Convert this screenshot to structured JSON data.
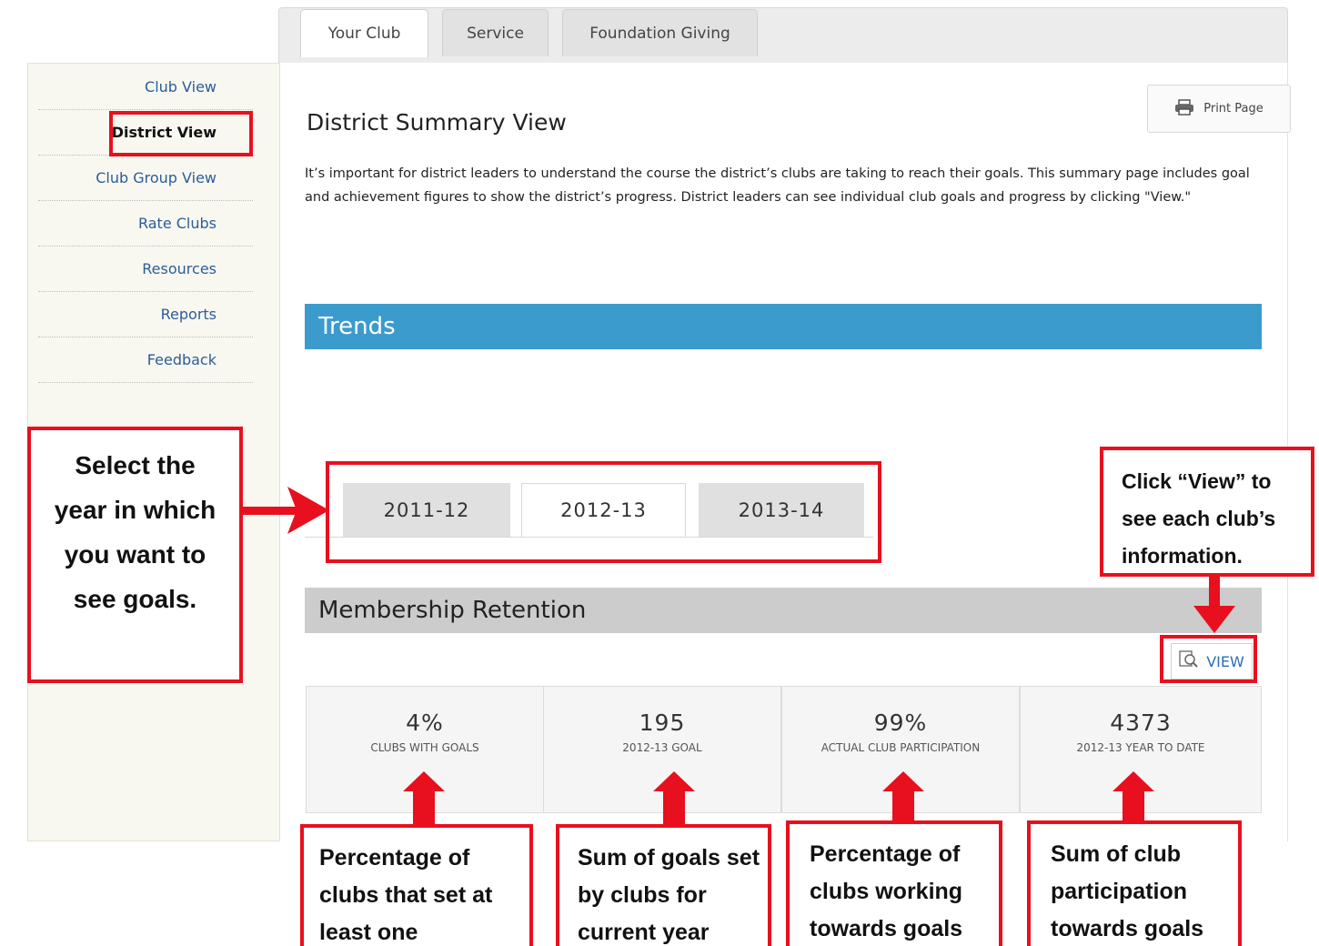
{
  "tabs": [
    {
      "label": "Your Club",
      "active": true
    },
    {
      "label": "Service",
      "active": false
    },
    {
      "label": "Foundation Giving",
      "active": false
    }
  ],
  "sidebar": {
    "items": [
      {
        "label": "Club View"
      },
      {
        "label": "District View",
        "active": true
      },
      {
        "label": "Club Group View"
      },
      {
        "label": "Rate Clubs"
      },
      {
        "label": "Resources"
      },
      {
        "label": "Reports"
      },
      {
        "label": "Feedback"
      }
    ]
  },
  "header": {
    "print_label": "Print Page",
    "title": "District Summary View",
    "intro": "It’s important for district leaders to understand the course the district’s clubs are taking to reach their goals. This summary page includes goal and achievement figures to show the district’s progress. District leaders can see individual club goals and progress by clicking \"View.\""
  },
  "trends": {
    "title": "Trends"
  },
  "years": [
    {
      "label": "2011-12",
      "active": false
    },
    {
      "label": "2012-13",
      "active": true
    },
    {
      "label": "2013-14",
      "active": false
    }
  ],
  "membership": {
    "title": "Membership Retention",
    "view_label": "VIEW",
    "stats": [
      {
        "value": "4%",
        "label": "CLUBS WITH GOALS"
      },
      {
        "value": "195",
        "label": "2012-13 GOAL"
      },
      {
        "value": "99%",
        "label": "ACTUAL CLUB PARTICIPATION"
      },
      {
        "value": "4373",
        "label": "2012-13 YEAR TO DATE"
      }
    ]
  },
  "annotations": {
    "select_year": "Select the year in which you want to see goals.",
    "click_view": "Click “View” to see each club’s information.",
    "pct_clubs": "Percentage of clubs that set at least one",
    "sum_goals": "Sum of goals set by clubs for current year",
    "pct_working": "Percentage of clubs working towards goals",
    "sum_participation": "Sum of club participation towards goals"
  },
  "colors": {
    "accent_blue": "#3b9bcd",
    "annotation_red": "#e8101e",
    "link_blue": "#2b5d98"
  },
  "icons": {
    "print": "printer-icon",
    "view": "magnifier-icon"
  }
}
